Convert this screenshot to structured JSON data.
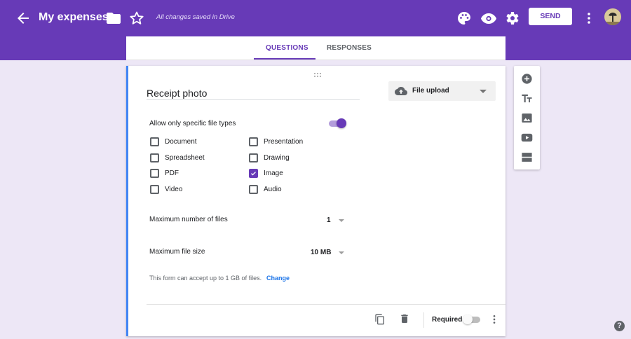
{
  "header": {
    "title": "My expenses",
    "saved_status": "All changes saved in Drive",
    "send_label": "SEND",
    "icons": [
      "back-arrow-icon",
      "folder-icon",
      "star-icon",
      "palette-icon",
      "eye-icon",
      "gear-icon",
      "more-vert-icon"
    ],
    "color": "#673ab7"
  },
  "tabs": [
    {
      "label": "QUESTIONS",
      "active": true
    },
    {
      "label": "RESPONSES",
      "active": false
    }
  ],
  "question": {
    "title": "Receipt photo",
    "type_label": "File upload",
    "allow_specific_label": "Allow only specific file types",
    "allow_specific_enabled": true,
    "file_types": [
      {
        "label": "Document",
        "checked": false
      },
      {
        "label": "Presentation",
        "checked": false
      },
      {
        "label": "Spreadsheet",
        "checked": false
      },
      {
        "label": "Drawing",
        "checked": false
      },
      {
        "label": "PDF",
        "checked": false
      },
      {
        "label": "Image",
        "checked": true
      },
      {
        "label": "Video",
        "checked": false
      },
      {
        "label": "Audio",
        "checked": false
      }
    ],
    "max_files_label": "Maximum number of files",
    "max_files_value": "1",
    "max_size_label": "Maximum file size",
    "max_size_value": "10 MB",
    "capacity_note": "This form can accept up to 1 GB of files.",
    "change_link": "Change",
    "required_label": "Required",
    "required_enabled": false
  },
  "side_toolbar": [
    "add-circle-icon",
    "title-text-icon",
    "image-icon",
    "video-icon",
    "section-icon"
  ],
  "colors": {
    "accent": "#673ab7",
    "background": "#ede7f6",
    "card_border": "#4285f4",
    "link": "#1a73e8"
  }
}
